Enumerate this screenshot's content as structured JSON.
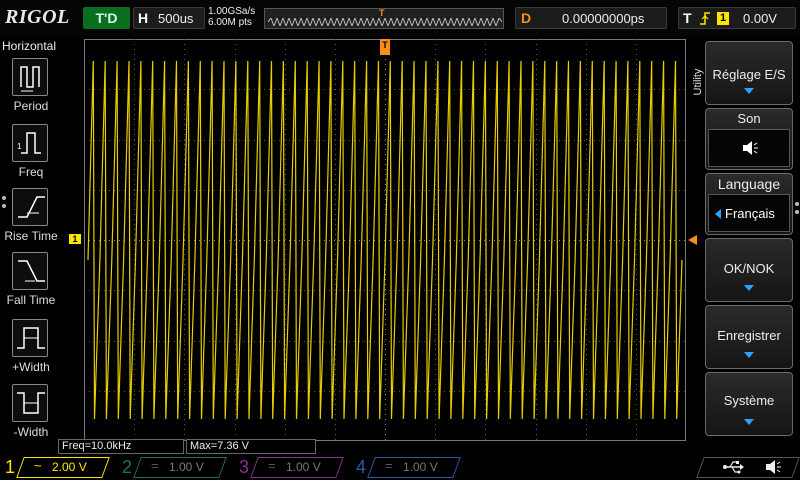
{
  "top": {
    "logo": "RIGOL",
    "run_state": "T'D",
    "timebase_letter": "H",
    "timebase": "500us",
    "sample_rate": "1.00GSa/s",
    "mem_depth": "6.00M pts",
    "trig_pos_marker": "T",
    "delay_letter": "D",
    "delay": "0.00000000ps",
    "trigger_letter": "T",
    "trigger_edge_icon": "rising-edge-icon",
    "trigger_source": "1",
    "trigger_level": "0.00V"
  },
  "left": {
    "title": "Horizontal",
    "items": [
      {
        "label": "Period",
        "icon": "period-icon"
      },
      {
        "label": "Freq",
        "icon": "freq-icon"
      },
      {
        "label": "Rise Time",
        "icon": "rise-time-icon"
      },
      {
        "label": "Fall Time",
        "icon": "fall-time-icon"
      },
      {
        "label": "+Width",
        "icon": "pos-width-icon"
      },
      {
        "label": "-Width",
        "icon": "neg-width-icon"
      }
    ]
  },
  "markers": {
    "trigger": "T",
    "ch1": "1"
  },
  "menu": {
    "tab": "Utility",
    "buttons": [
      {
        "label": "Réglage E/S"
      },
      {
        "label": "Son",
        "icon": "speaker-icon"
      },
      {
        "label": "Language",
        "value": "Français"
      },
      {
        "label": "OK/NOK"
      },
      {
        "label": "Enregistrer"
      },
      {
        "label": "Système"
      }
    ]
  },
  "results": {
    "freq": "Freq=10.0kHz",
    "max": "Max=7.36 V"
  },
  "channels": [
    {
      "num": "1",
      "coupling": "~",
      "scale": "2.00 V",
      "color": "#ffe600",
      "active": true
    },
    {
      "num": "2",
      "coupling": "=",
      "scale": "1.00 V",
      "color": "#2fb7a8",
      "active": false
    },
    {
      "num": "3",
      "coupling": "=",
      "scale": "1.00 V",
      "color": "#d44bd4",
      "active": false
    },
    {
      "num": "4",
      "coupling": "=",
      "scale": "1.00 V",
      "color": "#3a7bd5",
      "active": false
    }
  ],
  "status_icons": [
    "usb-icon",
    "speaker-icon"
  ],
  "colors": {
    "ch1": "#ffe600",
    "trigger": "#ff8c1a",
    "accent": "#2aa3ff"
  },
  "waveform": {
    "type": "spike-train",
    "cycles": 50,
    "channel": "1",
    "volts_per_div": 2.0
  }
}
